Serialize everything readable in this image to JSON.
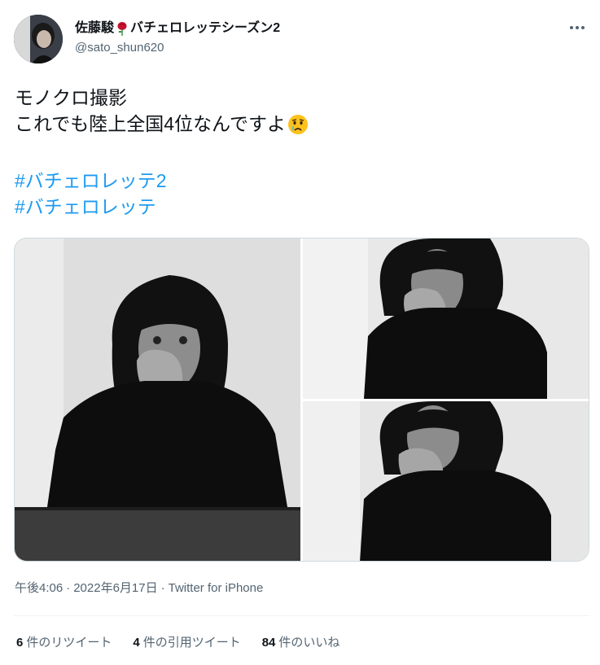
{
  "author": {
    "display_name": "佐藤駿",
    "display_name_suffix": "バチェロレッテシーズン2",
    "handle": "@sato_shun620",
    "avatar": "profile-photo"
  },
  "tweet": {
    "line1": "モノクロ撮影",
    "line2": "これでも陸上全国4位なんですよ",
    "hashtag1": "#バチェロレッテ2",
    "hashtag2": "#バチェロレッテ"
  },
  "icons": {
    "emoji_in_name": "rose-icon",
    "emoji_in_text": "crying-face-icon",
    "more": "more-dots-icon"
  },
  "meta": {
    "time": "午後4:06",
    "separator": "·",
    "date": "2022年6月17日",
    "source": "Twitter for iPhone"
  },
  "stats": {
    "retweets_count": "6",
    "retweets_label": "件のリツイート",
    "quotes_count": "4",
    "quotes_label": "件の引用ツイート",
    "likes_count": "84",
    "likes_label": "件のいいね"
  },
  "colors": {
    "text": "#0f1419",
    "secondary": "#536471",
    "link": "#1d9bf0",
    "border": "#cfd9de"
  }
}
